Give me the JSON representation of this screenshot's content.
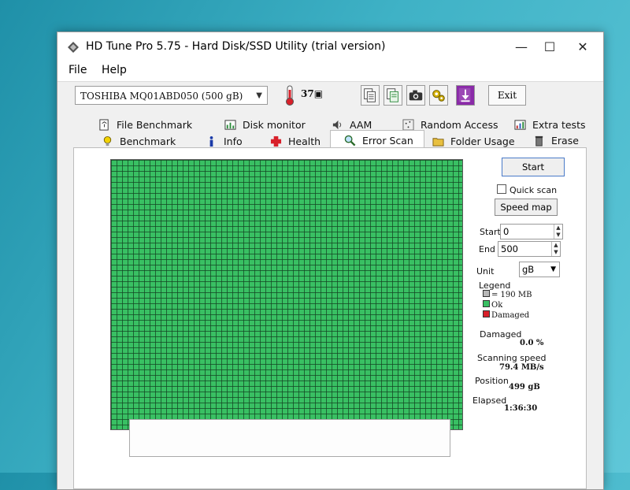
{
  "window": {
    "title": "HD Tune Pro 5.75 - Hard Disk/SSD Utility (trial version)",
    "controls": {
      "minimize": "—",
      "maximize": "☐",
      "close": "✕"
    }
  },
  "menu": {
    "items": [
      "File",
      "Help"
    ]
  },
  "toolbar": {
    "drive": "TOSHIBA MQ01ABD050 (500 gB)",
    "temperature": "37",
    "exit_label": "Exit",
    "icons": [
      "copy-info-icon",
      "copy-text-icon",
      "screenshot-icon",
      "options-icon",
      "save-icon"
    ]
  },
  "tabs": {
    "row1": [
      "File Benchmark",
      "Disk monitor",
      "AAM",
      "Random Access",
      "Extra tests"
    ],
    "row2": [
      "Benchmark",
      "Info",
      "Health",
      "Error Scan",
      "Folder Usage",
      "Erase"
    ],
    "active": "Error Scan"
  },
  "scan": {
    "start_button": "Start",
    "quick_scan_label": "Quick scan",
    "speed_map_button": "Speed map",
    "start_label": "Start",
    "start_value": "0",
    "end_label": "End",
    "end_value": "500",
    "unit_label": "Unit",
    "unit_value": "gB"
  },
  "legend": {
    "title": "Legend",
    "block": "= 190 MB",
    "ok": "Ok",
    "damaged": "Damaged",
    "colors": {
      "block": "#b8b8b8",
      "ok": "#39c063",
      "damaged": "#d8202a"
    }
  },
  "stats": {
    "damaged_label": "Damaged",
    "damaged_value": "0.0 %",
    "speed_label": "Scanning speed",
    "speed_value": "79.4 MB/s",
    "position_label": "Position",
    "position_value": "499 gB",
    "elapsed_label": "Elapsed",
    "elapsed_value": "1:36:30"
  }
}
